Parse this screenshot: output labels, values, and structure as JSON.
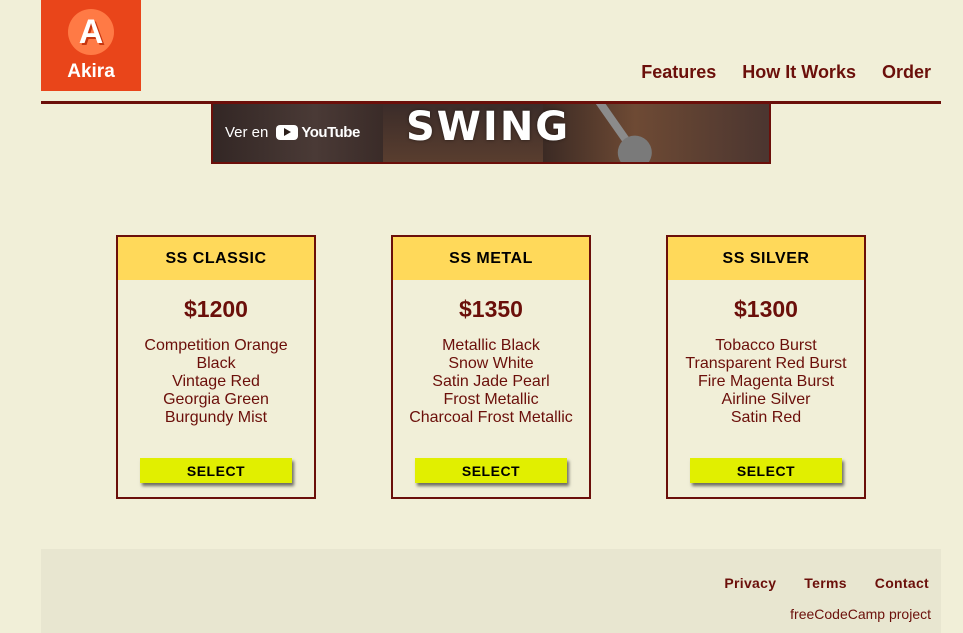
{
  "brand": {
    "logo_letter": "A",
    "name": "Akira"
  },
  "nav": {
    "items": [
      "Features",
      "How It Works",
      "Order"
    ]
  },
  "video": {
    "watch_on": "Ver en",
    "youtube": "YouTube",
    "title_overlay": "SWING"
  },
  "products": [
    {
      "name": "SS CLASSIC",
      "price": "$1200",
      "colors": [
        "Competition Orange",
        "Black",
        "Vintage Red",
        "Georgia Green",
        "Burgundy Mist"
      ],
      "button": "SELECT"
    },
    {
      "name": "SS METAL",
      "price": "$1350",
      "colors": [
        "Metallic Black",
        "Snow White",
        "Satin Jade Pearl",
        "Frost Metallic",
        "Charcoal Frost Metallic"
      ],
      "button": "SELECT"
    },
    {
      "name": "SS SILVER",
      "price": "$1300",
      "colors": [
        "Tobacco Burst",
        "Transparent Red Burst",
        "Fire Magenta Burst",
        "Airline Silver",
        "Satin Red"
      ],
      "button": "SELECT"
    }
  ],
  "footer": {
    "links": [
      "Privacy",
      "Terms",
      "Contact"
    ],
    "note": "freeCodeCamp project"
  },
  "colors": {
    "background": "#f1efd8",
    "brand": "#e9451a",
    "accent_text": "#6b0f0a",
    "card_header": "#ffd95a",
    "button": "#e1ef00"
  }
}
